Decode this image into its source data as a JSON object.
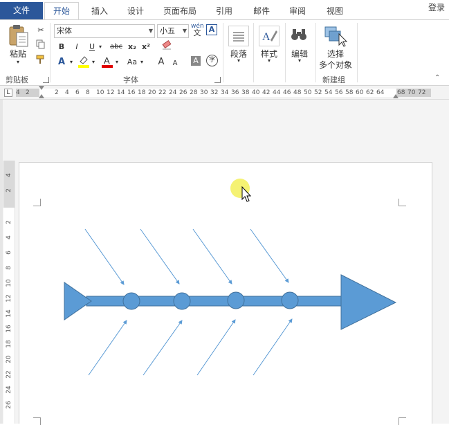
{
  "tabs": {
    "file": "文件",
    "home": "开始",
    "insert": "插入",
    "design": "设计",
    "layout": "页面布局",
    "references": "引用",
    "mailings": "邮件",
    "review": "审阅",
    "view": "视图"
  },
  "login": "登录",
  "clipboard": {
    "paste": "粘贴",
    "group": "剪贴板"
  },
  "font": {
    "name": "宋体",
    "size": "小五",
    "bold": "B",
    "italic": "I",
    "underline": "U",
    "strike": "abc",
    "subscript": "x₂",
    "superscript": "x²",
    "wen": "wén",
    "wen_char": "文",
    "border_char": "A",
    "grow": "A",
    "shrink": "A",
    "aa": "Aa",
    "shade_char": "A",
    "enclose_char": "字",
    "group": "字体"
  },
  "paragraph": {
    "label": "段落"
  },
  "styles": {
    "label": "样式"
  },
  "editing": {
    "label": "编辑"
  },
  "select": {
    "label1": "选择",
    "label2": "多个对象",
    "group": "新建组"
  },
  "hruler_ticks": [
    "4",
    "2",
    "2",
    "4",
    "6",
    "8",
    "10",
    "12",
    "14",
    "16",
    "18",
    "20",
    "22",
    "24",
    "26",
    "28",
    "30",
    "32",
    "34",
    "36",
    "38",
    "40",
    "42",
    "44",
    "46",
    "48",
    "50",
    "52",
    "54",
    "56",
    "58",
    "60",
    "62",
    "64",
    "68",
    "70",
    "72"
  ],
  "vruler_ticks": [
    "4",
    "2",
    "2",
    "4",
    "6",
    "8",
    "10",
    "12",
    "14",
    "16",
    "18",
    "20",
    "22",
    "24",
    "26"
  ],
  "colors": {
    "accent": "#2b579a",
    "shape_fill": "#5b9bd5",
    "shape_stroke": "#41719c",
    "highlight": "#ffff00",
    "font_red": "#e00000"
  }
}
